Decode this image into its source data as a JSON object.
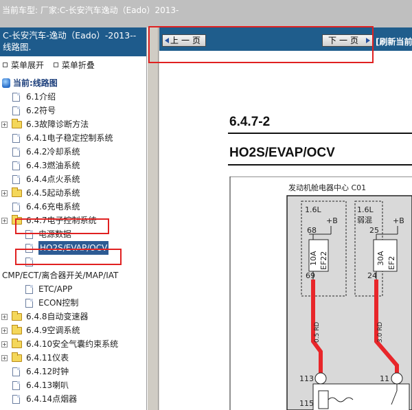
{
  "header": {
    "vehicle_line": "当前车型:   厂家:C-长安汽车逸动（Eado）2013-"
  },
  "sidebar": {
    "title": "C-长安汽车-逸动（Eado）-2013--线路图.",
    "expand_label": "菜单展开",
    "collapse_label": "菜单折叠",
    "root_label": "当前:线路图",
    "items": [
      {
        "label": "6.1介绍",
        "type": "doc"
      },
      {
        "label": "6.2符号",
        "type": "doc"
      },
      {
        "label": "6.3故障诊断方法",
        "type": "folder"
      },
      {
        "label": "6.4.1电子稳定控制系统",
        "type": "doc"
      },
      {
        "label": "6.4.2冷却系统",
        "type": "doc"
      },
      {
        "label": "6.4.3燃油系统",
        "type": "doc"
      },
      {
        "label": "6.4.4点火系统",
        "type": "doc"
      },
      {
        "label": "6.4.5起动系统",
        "type": "folder"
      },
      {
        "label": "6.4.6充电系统",
        "type": "doc"
      },
      {
        "label": "6.4.7电子控制系统",
        "type": "folder"
      },
      {
        "label": "电源数据",
        "type": "subdoc"
      },
      {
        "label": "HO2S/EVAP/OCV",
        "type": "subdoc"
      },
      {
        "label": "",
        "type": "subdoc"
      },
      {
        "label": "CMP/ECT/离合器开关/MAP/IAT",
        "type": "wrap"
      },
      {
        "label": "ETC/APP",
        "type": "subdoc"
      },
      {
        "label": "ECON控制",
        "type": "subdoc"
      },
      {
        "label": "6.4.8自动变速器",
        "type": "folder"
      },
      {
        "label": "6.4.9空调系统",
        "type": "folder"
      },
      {
        "label": "6.4.10安全气囊约束系统",
        "type": "folder"
      },
      {
        "label": "6.4.11仪表",
        "type": "folder"
      },
      {
        "label": "6.4.12时钟",
        "type": "doc"
      },
      {
        "label": "6.4.13喇叭",
        "type": "doc"
      },
      {
        "label": "6.4.14点烟器",
        "type": "doc"
      }
    ]
  },
  "content": {
    "prev_label": "上一页",
    "next_label": "下一页",
    "refresh_label": "[刷新当前",
    "page_code": "6.4.7-2",
    "page_title": "HO2S/EVAP/OCV"
  },
  "diagram": {
    "center_label": "发动机舱电器中心  C01",
    "left_box": "1.6L",
    "right_box": "1.6L",
    "right_box_note": "弱混",
    "pin_plus_b": "+B",
    "pin_68": "68",
    "pin_69": "69",
    "pin_25": "25",
    "pin_24": "24",
    "fuse_left_rating": "10A",
    "fuse_left_name": "EF22",
    "fuse_right_rating": "30A",
    "fuse_right_name": "EF2",
    "wire_left": "0.5 RD",
    "wire_right": "3.0 RD",
    "pin_113": "113",
    "pin_115": "115",
    "pin_11": "11",
    "colors": {
      "wire": "#e8262a",
      "box_fill": "#d9d9d9"
    }
  }
}
